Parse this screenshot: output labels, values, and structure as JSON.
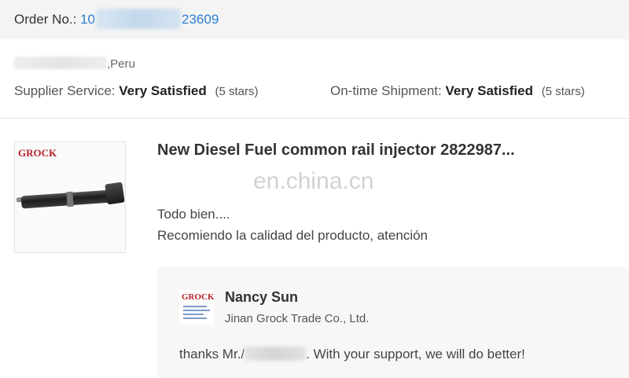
{
  "order": {
    "label": "Order No.:",
    "number_prefix": "10",
    "number_suffix": "23609"
  },
  "buyer": {
    "location": ",Peru"
  },
  "ratings": {
    "supplier": {
      "label": "Supplier Service:",
      "value": "Very Satisfied",
      "stars": "(5 stars)"
    },
    "shipment": {
      "label": "On-time Shipment:",
      "value": "Very Satisfied",
      "stars": "(5 stars)"
    }
  },
  "product": {
    "title": "New Diesel Fuel common rail injector 2822987...",
    "thumb_brand": "GROCK"
  },
  "watermark": "en.china.cn",
  "review": {
    "line1": "Todo bien....",
    "line2": "Recomiendo la calidad del producto,  atención"
  },
  "reply": {
    "name": "Nancy Sun",
    "company": "Jinan Grock Trade Co., Ltd.",
    "logo_brand": "GROCK",
    "text_before": "thanks Mr./",
    "text_after": ". With your support, we will do better!"
  },
  "colors": {
    "link_blue": "#2b7fd1",
    "brand_red": "#b8212b"
  }
}
